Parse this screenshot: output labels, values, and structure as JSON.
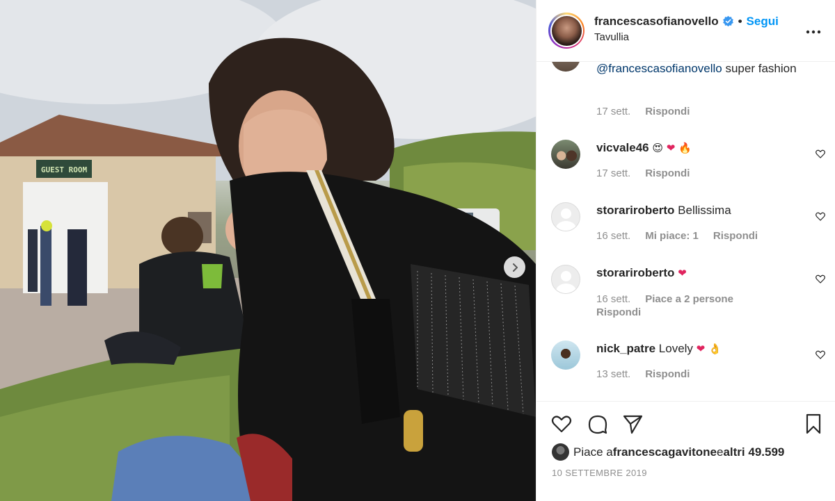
{
  "post": {
    "username": "francescasofianovello",
    "follow_label": "Segui",
    "location": "Tavullia",
    "separator": "•"
  },
  "photo": {
    "description_sign": "GUEST ROOM"
  },
  "comments": [
    {
      "mention": "@francescasofianovello",
      "text": " super fashion",
      "time": "17 sett.",
      "reply": "Rispondi"
    },
    {
      "user": "vicvale46",
      "emojis": [
        "😍",
        "❤",
        "🔥"
      ],
      "time": "17 sett.",
      "reply": "Rispondi"
    },
    {
      "user": "storariroberto",
      "text": "Bellissima",
      "time": "16 sett.",
      "likes": "Mi piace: 1",
      "reply": "Rispondi"
    },
    {
      "user": "storariroberto",
      "emojis": [
        "❤"
      ],
      "time": "16 sett.",
      "likes": "Piace a 2 persone",
      "reply": "Rispondi"
    },
    {
      "user": "nick_patre",
      "text": "Lovely",
      "emojis": [
        "❤",
        "👌"
      ],
      "time": "13 sett.",
      "reply": "Rispondi"
    }
  ],
  "likes": {
    "prefix": "Piace a ",
    "user": "francescagavitone",
    "middle": " e ",
    "count": "altri 49.599"
  },
  "date": "10 SETTEMBRE 2019",
  "colors": {
    "follow": "#0095f6",
    "verified": "#3897f0",
    "meta": "#8e8e8e"
  }
}
